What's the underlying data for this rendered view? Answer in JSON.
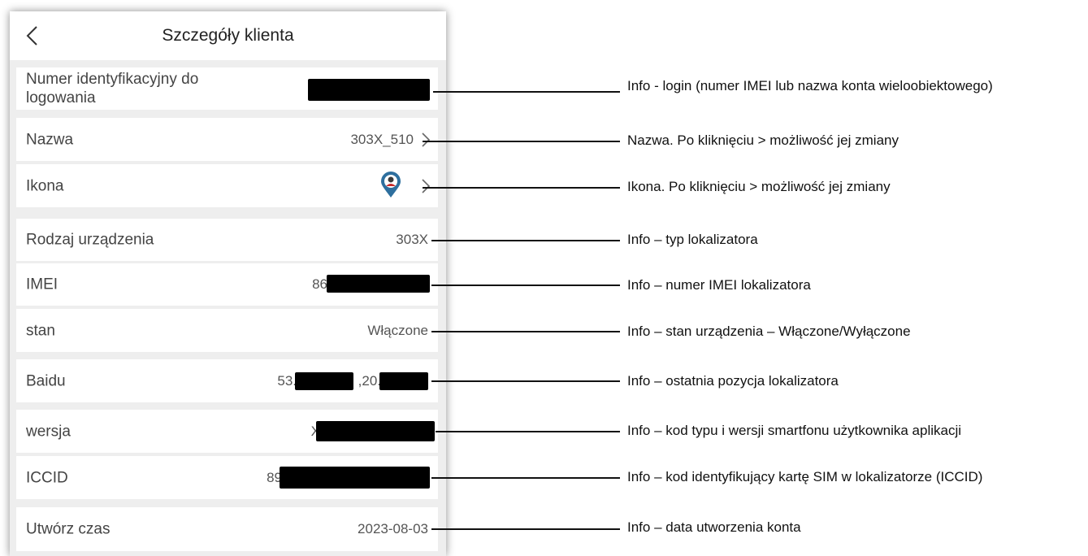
{
  "header": {
    "title": "Szczegóły klienta",
    "back_icon": "chevron-left-icon"
  },
  "rows": {
    "login": {
      "label": "Numer identyfikacyjny do logowania",
      "value": ""
    },
    "name": {
      "label": "Nazwa",
      "value": "303X_510"
    },
    "icon": {
      "label": "Ikona",
      "icon": "map-pin-avatar-icon"
    },
    "device_type": {
      "label": "Rodzaj urządzenia",
      "value": "303X"
    },
    "imei": {
      "label": "IMEI",
      "value": "86"
    },
    "state": {
      "label": "stan",
      "value": "Włączone"
    },
    "baidu": {
      "label": "Baidu",
      "value_a": "53.",
      "value_b": ",20."
    },
    "version": {
      "label": "wersja",
      "value": "X"
    },
    "iccid": {
      "label": "ICCID",
      "value": "89"
    },
    "created": {
      "label": "Utwórz czas",
      "value": "2023-08-03"
    }
  },
  "annotations": [
    "Info - login (numer IMEI lub nazwa konta wieloobiektowego)",
    "Nazwa. Po kliknięciu > możliwość jej zmiany",
    "Ikona. Po kliknięciu > możliwość jej zmiany",
    "Info – typ lokalizatora",
    "Info – numer IMEI lokalizatora",
    "Info – stan urządzenia – Włączone/Wyłączone",
    "Info – ostatnia pozycja lokalizatora",
    "Info – kod typu i wersji smartfonu użytkownika aplikacji",
    "Info – kod identyfikujący kartę SIM w lokalizatorze (ICCID)",
    "Info – data utworzenia konta"
  ],
  "colors": {
    "redaction": "#000000",
    "pin": "#2e6f9e",
    "background": "#eeeeee"
  }
}
